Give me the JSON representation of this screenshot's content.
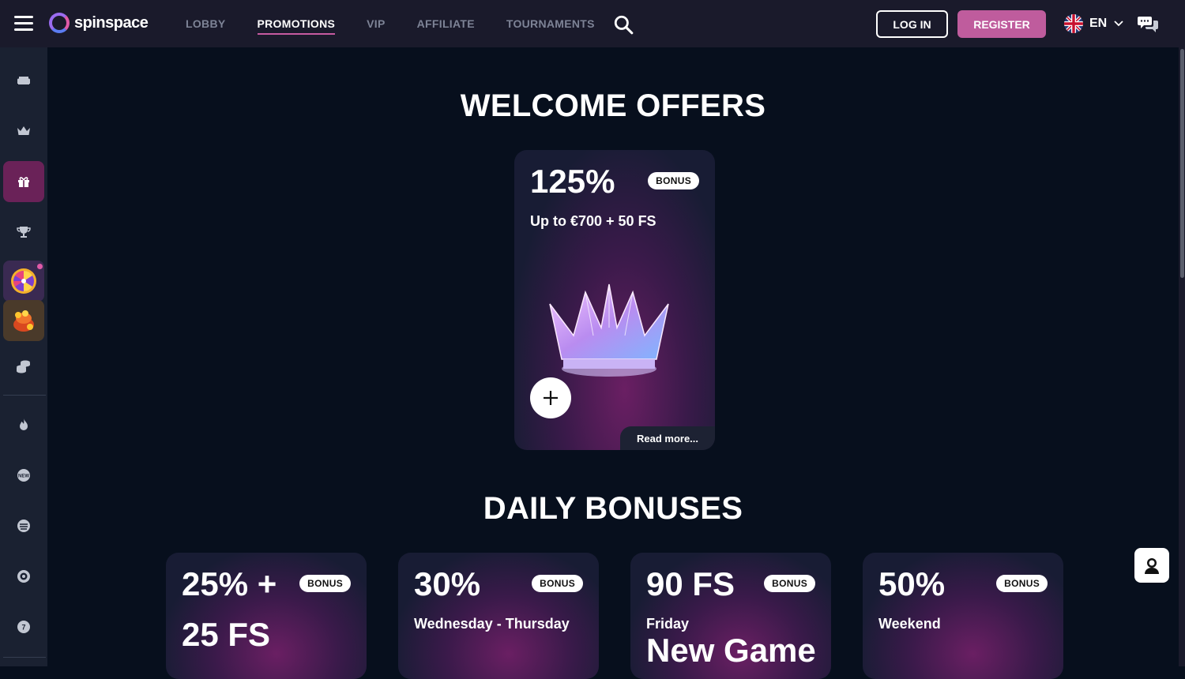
{
  "header": {
    "logo_text": "spinspace",
    "nav": [
      "LOBBY",
      "PROMOTIONS",
      "VIP",
      "AFFILIATE",
      "TOURNAMENTS"
    ],
    "active_nav": "PROMOTIONS",
    "login_label": "LOG IN",
    "register_label": "REGISTER",
    "language": "EN"
  },
  "sidebar": {
    "items": [
      "sofa-icon",
      "crown-icon",
      "gift-icon",
      "trophy-icon",
      "fortune-wheel-icon",
      "treasure-chest-icon",
      "coins-icon",
      "fire-icon",
      "new-icon",
      "stack-icon",
      "roulette-icon",
      "live-icon"
    ],
    "active": "gift-icon"
  },
  "welcome": {
    "title": "WELCOME OFFERS",
    "card": {
      "percent": "125%",
      "badge": "BONUS",
      "subtitle": "Up to €700 + 50 FS",
      "read_more": "Read more..."
    }
  },
  "daily": {
    "title": "DAILY BONUSES",
    "cards": [
      {
        "big": "25% +",
        "big2": "25 FS",
        "badge": "BONUS",
        "subtitle": ""
      },
      {
        "big": "30%",
        "badge": "BONUS",
        "subtitle": "Wednesday - Thursday"
      },
      {
        "big": "90 FS",
        "badge": "BONUS",
        "subtitle": "Friday",
        "extra": "New Game"
      },
      {
        "big": "50%",
        "badge": "BONUS",
        "subtitle": "Weekend"
      }
    ]
  },
  "colors": {
    "accent": "#bf5c9d",
    "background": "#070f1d",
    "topbar": "#1a1a2b",
    "sidebar": "#1a2131"
  }
}
